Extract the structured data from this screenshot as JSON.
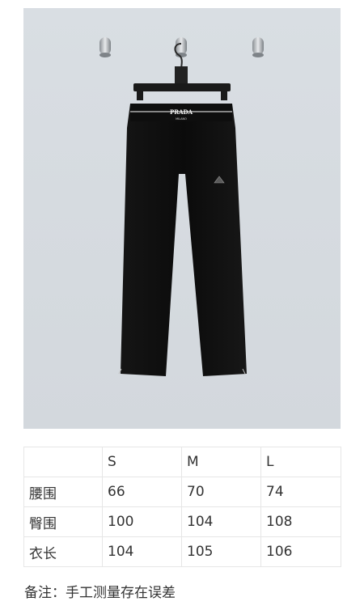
{
  "product_image": {
    "alt": "",
    "waistband_logo": "PRADA",
    "waistband_sublogo": "MILANO"
  },
  "size_table": {
    "header": [
      "",
      "S",
      "M",
      "L"
    ],
    "rows": [
      [
        "腰围",
        "66",
        "70",
        "74"
      ],
      [
        "臀围",
        "100",
        "104",
        "108"
      ],
      [
        "衣长",
        "104",
        "105",
        "106"
      ]
    ]
  },
  "note": "备注：手工测量存在误差",
  "colors": {
    "wall": "#d7dce1",
    "garment": "#0d0d0d",
    "table_border": "#e6e6e6"
  }
}
